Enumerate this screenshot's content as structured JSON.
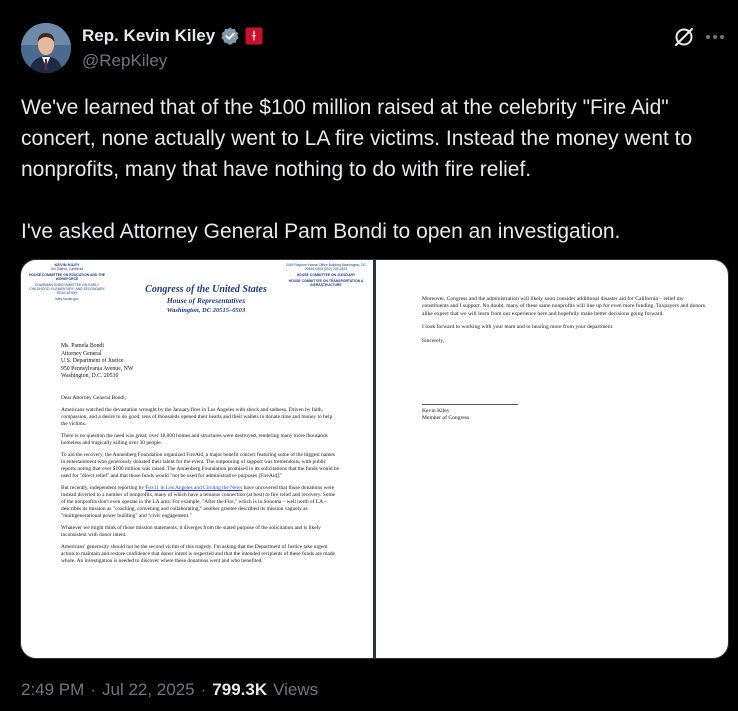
{
  "author": {
    "display_name": "Rep. Kevin Kiley",
    "handle": "@RepKiley",
    "verified_icon": "verified-badge-icon",
    "affiliation_icon": "house-seal-icon"
  },
  "colors": {
    "verified": "#829aab",
    "affiliation": "#c8102e",
    "muted": "#71767b"
  },
  "tweet": {
    "text": "We've learned that of the $100 million raised at the celebrity \"Fire Aid\" concert, none actually went to LA fire victims. Instead the money went to nonprofits, many that have nothing to do with fire relief.\n\nI've asked Attorney General Pam Bondi to open an investigation."
  },
  "letter": {
    "page1": {
      "letterhead_left": {
        "name": "KEVIN KILEY",
        "district": "3rd District, California",
        "committee1": "HOUSE COMMITTEE ON EDUCATION AND THE WORKFORCE",
        "subcommittee": "CHAIRMAN SUBCOMMITTEE ON EARLY CHILDHOOD, ELEMENTARY, AND SECONDARY EDUCATION",
        "web": "kiley.house.gov"
      },
      "letterhead_center": {
        "line1": "Congress of the United States",
        "line2": "House of Representatives",
        "line3": "Washington, DC 20515–0503"
      },
      "letterhead_right": {
        "office": "2445 Rayburn House Office Building Washington, DC 20515-0503 (202) 225-2523",
        "committee1": "HOUSE COMMITTEE ON JUDICIARY",
        "committee2": "HOUSE COMMITTEE ON TRANSPORTATION & INFRASTRUCTURE"
      },
      "address": "Ms. Pamela Bondi\nAttorney General\nU.S. Department of Justice\n950 Pennsylvania Avenue, NW\nWashington, D.C. 20530",
      "salutation": "Dear Attorney General Bondi,",
      "para1": "Americans watched the devastation wrought by the January fires in Los Angeles with shock and sadness. Driven by faith, compassion, and a desire to do good, tens of thousands opened their hearts and their wallets to donate time and money to help the victims.",
      "para2": "There is no question the need was great; over 18,000 homes and structures were destroyed, rendering many more thousands homeless and tragically killing over 30 people.",
      "para3": "To aid the recovery, the Annenberg Foundation organized FireAid, a major benefit concert featuring some of the biggest names in entertainment who generously donated their talent for the event. The outpouring of support was tremendous, with public reports noting that over $100 million was raised. The Annenberg Foundation promised in its solicitations that the funds would be used for \"direct relief\" and that those funds would \"not be used for administrative purposes [FireAid].\"",
      "para4_a": "But recently, independent reporting by ",
      "para4_link": "Fox11 in Los Angeles and Circling the News",
      "para4_b": " have uncovered that those donations were instead diverted to a number of nonprofits, many of which have a tenuous connection (at best) to fire relief and recovery. Some of the nonprofits don't even operate in the LA area. For example, \"After the Fire,\" which is in Sonoma – well north of LA – describes its mission as \"coaching, convening and collaborating,\" another grantee described its mission vaguely as \"multigenerational power building\" and \"civic engagement.\"",
      "para5": "Whatever we might think of those mission statements, it diverges from the stated purpose of the solicitation and is likely inconsistent with donor intent.",
      "para6": "Americans' generosity should not be the second victim of this tragedy. I'm asking that the Department of Justice take urgent action to maintain and restore confidence that donor intent is respected and that the intended recipients of these funds are made whole. An investigation is needed to discover where these donations went and who benefited."
    },
    "page2": {
      "para1": "Moreover, Congress and the administration will likely soon consider additional disaster aid for California – relief my constituents and I support. No doubt, many of these same nonprofits will line up for even more funding. Taxpayers and donors alike expect that we will learn from our experience here and hopefully make better decisions going forward.",
      "para2": "I look forward to working with your team and to hearing more from your department.",
      "closing": "Sincerely,",
      "signature": "Kevin Kiley\nMember of Congress"
    }
  },
  "meta": {
    "time": "2:49 PM",
    "separator": "·",
    "date": "Jul 22, 2025",
    "views_count": "799.3K",
    "views_label": "Views"
  }
}
